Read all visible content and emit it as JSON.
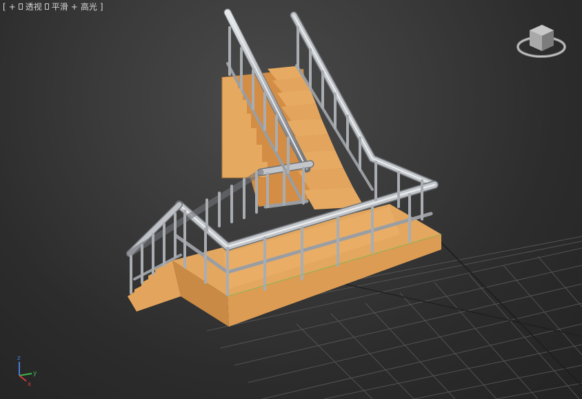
{
  "viewport": {
    "label": {
      "bracket_open": "[",
      "plus": "+",
      "view_mode": "透视",
      "shading_mode": "平滑",
      "plus2": "+",
      "highlight_mode": "高光",
      "bracket_close": "]"
    },
    "axis": {
      "z": "z",
      "x": "x",
      "y": "y"
    },
    "colors": {
      "stair_wood": "#e0a35c",
      "stair_wood_dark": "#c5863f",
      "stair_wood_light": "#f0b56e",
      "rail_metal": "#b9bdc2",
      "grid": "#5e5e5e",
      "axis_z": "#4a7bdc",
      "axis_x": "#d33a3a",
      "axis_y": "#3fb84a"
    },
    "viewcube": {
      "icon": "viewcube-icon"
    }
  }
}
